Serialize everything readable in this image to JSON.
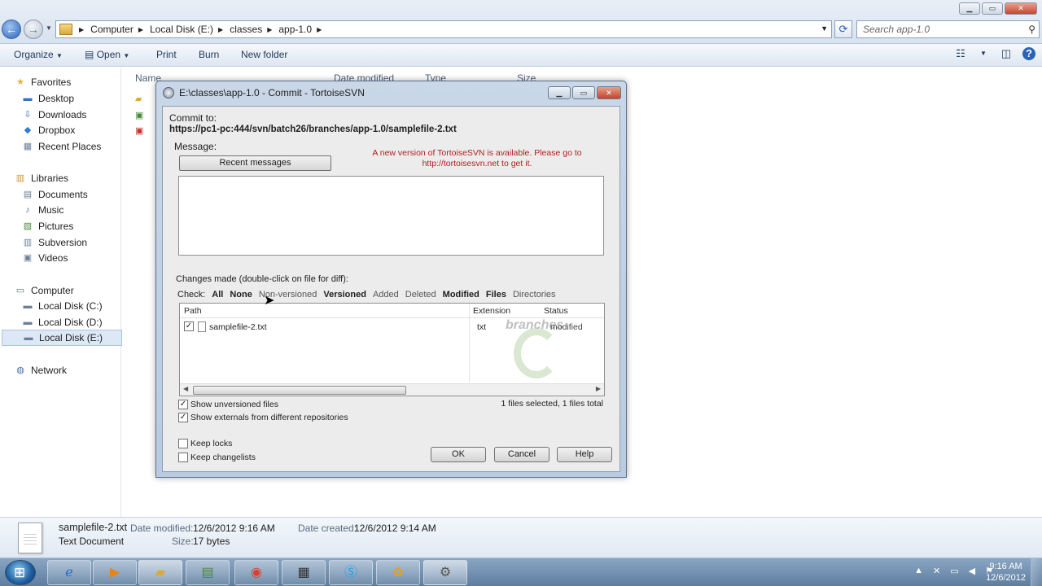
{
  "explorer": {
    "breadcrumb": [
      "Computer",
      "Local Disk (E:)",
      "classes",
      "app-1.0"
    ],
    "search_placeholder": "Search app-1.0",
    "toolbar": {
      "organize": "Organize",
      "open": "Open",
      "print": "Print",
      "burn": "Burn",
      "new_folder": "New folder"
    },
    "columns": {
      "name": "Name",
      "date_modified": "Date modified",
      "type": "Type",
      "size": "Size"
    },
    "nav": {
      "favorites": "Favorites",
      "desktop": "Desktop",
      "downloads": "Downloads",
      "dropbox": "Dropbox",
      "recent_places": "Recent Places",
      "libraries": "Libraries",
      "documents": "Documents",
      "music": "Music",
      "pictures": "Pictures",
      "subversion": "Subversion",
      "videos": "Videos",
      "computer": "Computer",
      "disk_c": "Local Disk (C:)",
      "disk_d": "Local Disk (D:)",
      "disk_e": "Local Disk (E:)",
      "network": "Network"
    }
  },
  "details": {
    "filename": "samplefile-2.txt",
    "filetype": "Text Document",
    "date_modified_label": "Date modified:",
    "date_modified": "12/6/2012 9:16 AM",
    "size_label": "Size:",
    "size": "17 bytes",
    "date_created_label": "Date created:",
    "date_created": "12/6/2012 9:14 AM"
  },
  "dialog": {
    "title": "E:\\classes\\app-1.0 - Commit - TortoiseSVN",
    "commit_to_label": "Commit to:",
    "commit_url": "https://pc1-pc:444/svn/batch26/branches/app-1.0/samplefile-2.txt",
    "message_label": "Message:",
    "recent_messages": "Recent messages",
    "notice_line1": "A new version of TortoiseSVN is available. Please go to",
    "notice_line2": "http://tortoisesvn.net to get it.",
    "changes_label": "Changes made (double-click on file for diff):",
    "check_label": "Check:",
    "filters": {
      "all": "All",
      "none": "None",
      "non_versioned": "Non-versioned",
      "versioned": "Versioned",
      "added": "Added",
      "deleted": "Deleted",
      "modified": "Modified",
      "files": "Files",
      "directories": "Directories"
    },
    "list_headers": {
      "path": "Path",
      "extension": "Extension",
      "status": "Status"
    },
    "rows": [
      {
        "path": "samplefile-2.txt",
        "extension": "txt",
        "status": "modified",
        "checked": true
      }
    ],
    "watermark": "branches",
    "show_unversioned": "Show unversioned files",
    "show_externals": "Show externals from different repositories",
    "summary": "1 files selected, 1 files total",
    "keep_locks": "Keep locks",
    "keep_changelists": "Keep changelists",
    "ok": "OK",
    "cancel": "Cancel",
    "help": "Help"
  },
  "taskbar": {
    "time": "9:16 AM",
    "date": "12/6/2012"
  },
  "colors": {
    "notice_red": "#b01e1e",
    "dialog_frame": "#c9d7e7",
    "taskbar": "#6f8db0"
  }
}
